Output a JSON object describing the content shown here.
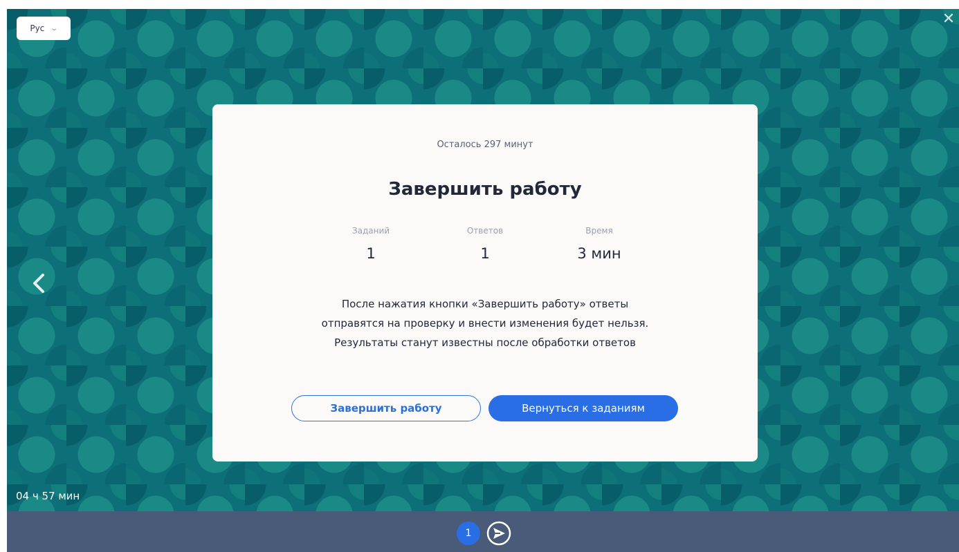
{
  "language_selector": {
    "value": "Рус",
    "chevron_icon": "chevron-down-icon"
  },
  "timer": {
    "text": "04 ч 57 мин"
  },
  "modal": {
    "remaining_text": "Осталось 297 минут",
    "title": "Завершить работу",
    "stats": [
      {
        "label": "Заданий",
        "value": "1"
      },
      {
        "label": "Ответов",
        "value": "1"
      },
      {
        "label": "Время",
        "value": "3 мин"
      }
    ],
    "notice_lines": [
      "После нажатия кнопки «Завершить работу» ответы",
      "отправятся на проверку и внести изменения будет нельзя.",
      "Результаты станут известны после обработки ответов"
    ],
    "finish_button_label": "Завершить работу",
    "back_button_label": "Вернуться к заданиям"
  },
  "pagination": {
    "current_page": "1"
  },
  "colors": {
    "background_teal": "#0d6f77",
    "accent_blue": "#2a6ee6",
    "bottom_bar": "#495b78",
    "modal_bg": "#fbfaf8"
  },
  "icons": {
    "close": "close-icon",
    "prev": "chevron-left-icon",
    "send": "send-icon"
  }
}
